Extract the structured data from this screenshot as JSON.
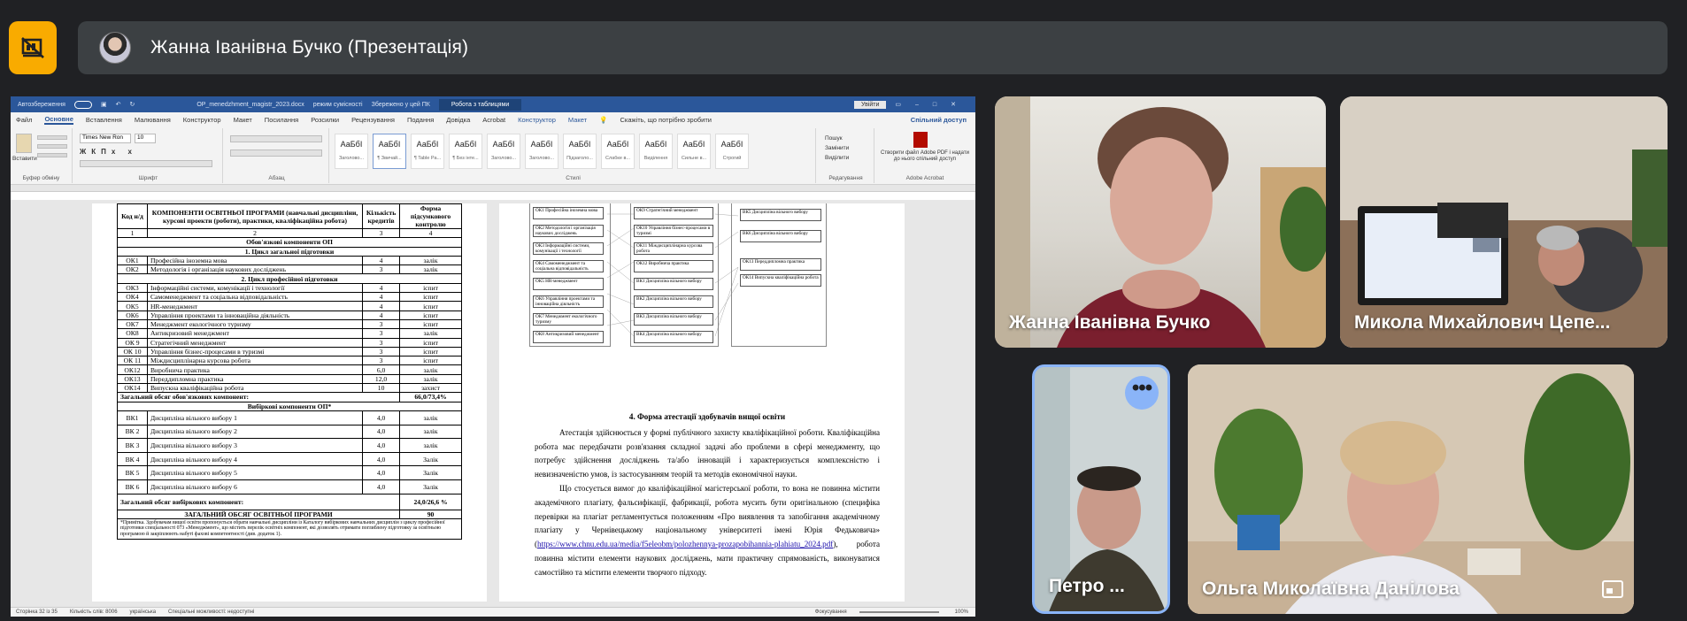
{
  "meeting": {
    "presenter_label": "Жанна Іванівна Бучко (Презентація)",
    "present_icon": "presentation-off-icon",
    "accent": "#f9ab00"
  },
  "word": {
    "autosave": "Автозбереження",
    "doc_title": "OP_menedzhment_magistr_2023.docx",
    "mode": "режим сумісності",
    "saved": "Збережено у цей ПК",
    "tools_tab": "Робота з таблицями",
    "signin": "Увійти",
    "menu": [
      "Файл",
      "Основне",
      "Вставлення",
      "Малювання",
      "Конструктор",
      "Макет",
      "Посилання",
      "Розсилки",
      "Рецензування",
      "Подання",
      "Довідка",
      "Acrobat",
      "Конструктор",
      "Макет"
    ],
    "active_menu": "Основне",
    "tell_me": "Скажіть, що потрібно зробити",
    "share": "Спільний доступ",
    "font": "Times New Ron",
    "size": "10",
    "groups": [
      "Буфер обміну",
      "Шрифт",
      "Абзац",
      "Стилі",
      "Редагування",
      "Adobe Acrobat"
    ],
    "paste": "Вставити",
    "styles": [
      {
        "sample": "АаБбІ",
        "name": "Заголово..."
      },
      {
        "sample": "АаБбІ",
        "name": "¶ Звичай..."
      },
      {
        "sample": "АаБбІ",
        "name": "¶ Table Pa..."
      },
      {
        "sample": "АаБбІ",
        "name": "¶ Без інте..."
      },
      {
        "sample": "АаБбІ",
        "name": "Заголово..."
      },
      {
        "sample": "АаБбІ",
        "name": "Заголово..."
      },
      {
        "sample": "АаБбІ",
        "name": "Підзаголо..."
      },
      {
        "sample": "АаБбІ",
        "name": "Слабке в..."
      },
      {
        "sample": "АаБбІ",
        "name": "Виділення"
      },
      {
        "sample": "АаБбІ",
        "name": "Сильне в..."
      },
      {
        "sample": "АаБбІ",
        "name": "Строгий"
      }
    ],
    "editing": [
      "Пошук",
      "Замінити",
      "Виділити"
    ],
    "acrobat_label": "Створити файл Adobe PDF і надати до нього спільний доступ",
    "status_page": "Сторінка 32 із 35",
    "status_words": "Кількість слів: 8006",
    "status_lang": "українська",
    "status_access": "Спеціальні можливості: недоступні",
    "status_focus": "Фокусування",
    "zoom": "100%"
  },
  "table": {
    "headers": [
      "Код н/д",
      "КОМПОНЕНТИ ОСВІТНЬОЇ ПРОГРАМИ (навчальні дисципліни, курсові проекти (роботи), практики, кваліфікаційна робота)",
      "Кількість кредитів",
      "Форма підсумкового контролю"
    ],
    "numbers": [
      "1",
      "2",
      "3",
      "4"
    ],
    "mandatory_title": "Обов'язкові компоненти ОП",
    "cycle1": "1.  Цикл загальної підготовки",
    "cycle1_rows": [
      [
        "ОК1",
        "Професійна іноземна мова",
        "4",
        "залік"
      ],
      [
        "ОК2",
        "Методологія і організація наукових досліджень",
        "3",
        "залік"
      ]
    ],
    "cycle2": "2.  Цикл професійної підготовки",
    "cycle2_rows": [
      [
        "ОК3",
        "Інформаційні системи, комунікації і технології",
        "4",
        "іспит"
      ],
      [
        "ОК4",
        "Самоменеджмент та соціальна відповідальність",
        "4",
        "іспит"
      ],
      [
        "ОК5",
        "HR-менеджмент",
        "4",
        "іспит"
      ],
      [
        "ОК6",
        "Управління проектами та інноваційна діяльність",
        "4",
        "іспит"
      ],
      [
        "ОК7",
        "Менеджмент екологічного туризму",
        "3",
        "іспит"
      ],
      [
        "ОК8",
        "Антикризовий менеджмент",
        "3",
        "залік"
      ],
      [
        "ОК 9",
        "Стратегічний менеджмент",
        "3",
        "іспит"
      ],
      [
        "ОК 10",
        "Управління бізнес-процесами в туризмі",
        "3",
        "іспит"
      ],
      [
        "ОК 11",
        "Міждисциплінарна курсова робота",
        "3",
        "іспит"
      ],
      [
        "ОК12",
        "Виробнича практика",
        "6,0",
        "залік"
      ],
      [
        "ОК13",
        "Переддипломна практика",
        "12,0",
        "залік"
      ],
      [
        "ОК14",
        "Випускна кваліфікаційна робота",
        "10",
        "захист"
      ]
    ],
    "mandatory_total_label": "Загальний обсяг обов'язкових компонент:",
    "mandatory_total": "66,0/73,4%",
    "elective_title": "Вибіркові компоненти  ОП*",
    "elective_rows": [
      [
        "ВК1",
        "Дисципліна вільного вибору 1",
        "4,0",
        "залік"
      ],
      [
        "ВК 2",
        "Дисципліна вільного вибору 2",
        "4,0",
        "залік"
      ],
      [
        "ВК 3",
        "Дисципліна вільного вибору 3",
        "4,0",
        "залік"
      ],
      [
        "ВК 4",
        "Дисципліна вільного вибору 4",
        "4,0",
        "Залік"
      ],
      [
        "ВК 5",
        "Дисципліна вільного вибору 5",
        "4,0",
        "Залік"
      ],
      [
        "ВК 6",
        "Дисципліна вільного вибору 6",
        "4,0",
        "Залік"
      ]
    ],
    "elective_total_label": "Загальний обсяг вибіркових компонент:",
    "elective_total": "24,0/26,6 %",
    "grand_label": "ЗАГАЛЬНИЙ ОБСЯГ ОСВІТНЬОЇ ПРОГРАМИ",
    "grand_total": "90",
    "note": "*Примітка. Здобувачам вищої освіти пропонується обрати навчальні дисципліни із Каталогу вибіркових навчальних дисциплін з циклу професійної підготовки спеціальності 073 «Менеджмент», що містить перелік освітніх компонент, які дозволять отримати поглиблену підготовку за освітньою програмою й закріплюють набуті фахові компетентності (див. додаток 1)."
  },
  "diagram": {
    "col1": [
      "ОК1 Професійна іноземна мова",
      "ОК2 Методологія і організація наукових досліджень",
      "ОК3 Інформаційні системи, комунікації і технології",
      "ОК4 Самоменеджмент та соціальна відповідальність",
      "ОК5 HR-менеджмент",
      "ОК6 Управління проектами та інноваційна діяльність",
      "ОК7 Менеджмент екологічного туризму",
      "ОК8 Антикризовий менеджмент"
    ],
    "col2": [
      "ОК9 Стратегічний менеджмент",
      "ОК10 Управління бізнес-процесами в туризмі",
      "ОК11 Міждисциплінарна курсова робота",
      "ОК12 Виробнича практика",
      "ВК1 Дисципліна вільного вибору",
      "ВК2 Дисципліна вільного вибору",
      "ВК3 Дисципліна вільного вибору",
      "ВК4 Дисципліна вільного вибору"
    ],
    "col3": [
      "ВК5 Дисципліна вільного вибору",
      "ВК6 Дисципліна вільного вибору",
      "ОК13 Переддипломна практика",
      "ОК14 Випускна кваліфікаційна робота"
    ]
  },
  "right_text": {
    "heading": "4.  Форма атестації здобувачів вищої освіти",
    "p1": "Атестація здійснюється у формі публічного захисту кваліфікаційної роботи. Кваліфікаційна робота має передбачати розв'язання складної задачі або проблеми в сфері менеджменту, що потребує здійснення досліджень та/або інновацій і характеризується комплексністю і невизначеністю умов, із застосуванням теорій та методів економічної науки.",
    "p2a": "Що стосується вимог до кваліфікаційної магістерської роботи, то вона не повинна містити академічного плагіату, фальсифікації, фабрикації, робота мусить бути оригінальною (специфіка перевірки на плагіат регламентується положенням «Про виявлення та запобігання академічному плагіату у Чернівецькому національному університеті імені Юрія Федьковича» (",
    "link": "https://www.chnu.edu.ua/media/f5eleobm/polozhennya-prozapobihannia-plahiatu_2024.pdf",
    "p2b": "), робота повинна містити елементи наукових досліджень, мати практичну спрямованість, виконуватися самостійно та містити елементи творчого підходу."
  },
  "participants": [
    {
      "name": "Жанна Іванівна Бучко"
    },
    {
      "name": "Микола Михайлович Цепе..."
    },
    {
      "name": "Петро ..."
    },
    {
      "name": "Ольга Миколаївна Данілова"
    }
  ],
  "colors": {
    "bg": "#202124",
    "bar": "#3c4043",
    "word_blue": "#2b579a",
    "speaker_ring": "#8ab4f8"
  }
}
